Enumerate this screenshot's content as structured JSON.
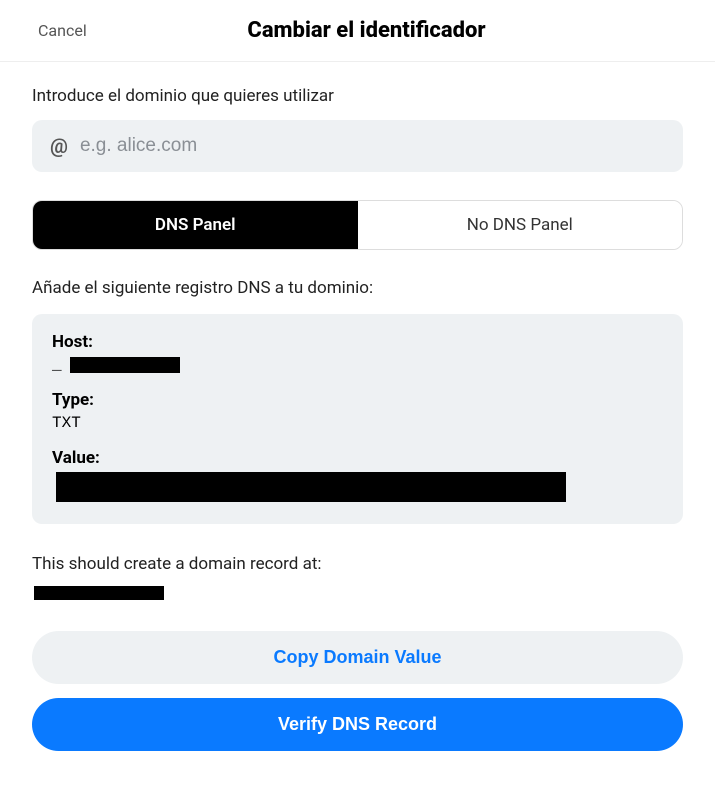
{
  "header": {
    "cancel": "Cancel",
    "title": "Cambiar el identificador"
  },
  "form": {
    "intro": "Introduce el dominio que quieres utilizar",
    "placeholder": "e.g. alice.com",
    "value": ""
  },
  "tabs": {
    "dns": "DNS Panel",
    "nodns": "No DNS Panel",
    "active": "dns"
  },
  "dns": {
    "instruction": "Añade el siguiente registro DNS a tu dominio:",
    "host_label": "Host:",
    "host_value": "",
    "type_label": "Type:",
    "type_value": "TXT",
    "value_label": "Value:",
    "value_value": ""
  },
  "record": {
    "note": "This should create a domain record at:",
    "value": ""
  },
  "buttons": {
    "copy": "Copy Domain Value",
    "verify": "Verify DNS Record"
  }
}
